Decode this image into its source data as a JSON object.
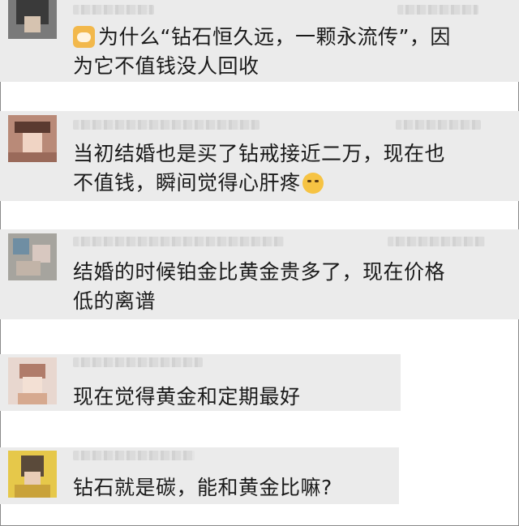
{
  "comments": [
    {
      "id": "c1",
      "emoji": "dog-emoji",
      "text": "为什么“钻石恒久远，一颗永流传”，因\n为它不值钱没人回收"
    },
    {
      "id": "c2",
      "emoji_end": "crying-face-emoji",
      "text": "当初结婚也是买了钻戒接近二万，现在也\n不值钱，瞬间觉得心肝疼"
    },
    {
      "id": "c3",
      "text": "结婚的时候铂金比黄金贵多了，现在价格\n低的离谱"
    },
    {
      "id": "c4",
      "text": "现在觉得黄金和定期最好"
    },
    {
      "id": "c5",
      "text": "钻石就是碳，能和黄金比嘛?"
    }
  ],
  "colors": {
    "bubble": "#ebebeb",
    "text": "#1a1a1a",
    "background": "#ffffff"
  }
}
